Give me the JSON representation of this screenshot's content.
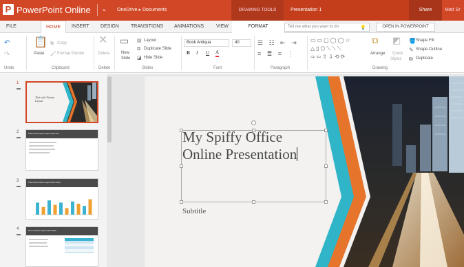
{
  "titlebar": {
    "app_title": "PowerPoint Online",
    "caret": "⌄",
    "breadcrumb": "OneDrive  ▸  Documents",
    "tools_label": "DRAWING TOOLS",
    "doc_title": "Presentation 1",
    "share": "Share",
    "user": "Matt Sr"
  },
  "tabs": [
    "FILE",
    "HOME",
    "INSERT",
    "DESIGN",
    "TRANSITIONS",
    "ANIMATIONS",
    "VIEW",
    "FORMAT"
  ],
  "active_tab": "HOME",
  "tellme": {
    "placeholder": "Tell me what you want to do",
    "icon": "lightbulb-icon"
  },
  "open_in_powerpoint": "OPEN IN POWERPOINT",
  "ribbon": {
    "undo": {
      "group": "Undo"
    },
    "clipboard": {
      "paste": "Paste",
      "copy": "Copy",
      "format_painter": "Format Painter",
      "group": "Clipboard"
    },
    "delete": {
      "label": "Delete",
      "group": "Delete"
    },
    "slides": {
      "new_slide": [
        "New",
        "Slide"
      ],
      "layout": "Layout",
      "duplicate_slide": "Duplicate Slide",
      "hide_slide": "Hide Slide",
      "group": "Slides"
    },
    "font": {
      "name": "Book Antiqua",
      "size": "40",
      "bold": "B",
      "italic": "I",
      "underline": "U",
      "font_color": "A",
      "group": "Font"
    },
    "paragraph": {
      "group": "Paragraph"
    },
    "drawing": {
      "arrange": "Arrange",
      "quick_styles": [
        "Quick",
        "Styles"
      ],
      "shape_fill": "Shape Fill",
      "shape_outline": "Shape Outline",
      "duplicate": "Duplicate",
      "group": "Drawing"
    }
  },
  "thumbnails": [
    {
      "number": "1",
      "title": [
        "Title with Picture",
        "Layout"
      ]
    },
    {
      "number": "2",
      "title": "Title and Content Layout with List"
    },
    {
      "number": "3",
      "title": "Title and Content Layout with Chart"
    },
    {
      "number": "4",
      "title": "Two Content Layout with Table"
    }
  ],
  "slide": {
    "title_line1": "My Spiffy Office",
    "title_line2": "Online Presentation",
    "subtitle": "Subtitle"
  },
  "colors": {
    "accent": "#d24726",
    "teal": "#2fb5c7",
    "orange": "#e7742b",
    "bar_teal": "#3bb3d1",
    "bar_orange": "#f0a030"
  },
  "thumb_chart_values": [
    0.55,
    0.35,
    0.65,
    0.45,
    0.55,
    0.3,
    0.6,
    0.5,
    0.4,
    0.7
  ]
}
